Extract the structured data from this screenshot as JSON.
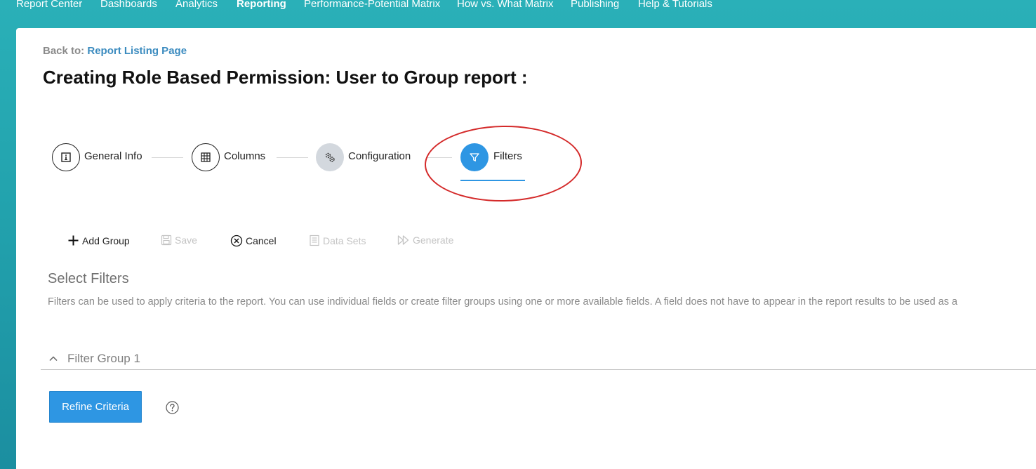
{
  "nav": {
    "items": [
      {
        "label": "Report Center",
        "active": false
      },
      {
        "label": "Dashboards",
        "active": false
      },
      {
        "label": "Analytics",
        "active": false
      },
      {
        "label": "Reporting",
        "active": true
      },
      {
        "label": "Performance-Potential Matrix",
        "active": false
      },
      {
        "label": "How vs. What Matrix",
        "active": false
      },
      {
        "label": "Publishing",
        "active": false
      },
      {
        "label": "Help & Tutorials",
        "active": false
      }
    ]
  },
  "header": {
    "back_prefix": "Back to:",
    "back_link": "Report Listing Page",
    "title": "Creating Role Based Permission: User to Group report :"
  },
  "steps": [
    {
      "label": "General Info",
      "icon": "info-icon",
      "state": "done"
    },
    {
      "label": "Columns",
      "icon": "grid-icon",
      "state": "done"
    },
    {
      "label": "Configuration",
      "icon": "gears-icon",
      "state": "pending"
    },
    {
      "label": "Filters",
      "icon": "filter-icon",
      "state": "active"
    }
  ],
  "toolbar": {
    "add_group": "Add Group",
    "save": "Save",
    "cancel": "Cancel",
    "data_sets": "Data Sets",
    "generate": "Generate"
  },
  "filters": {
    "title": "Select Filters",
    "description": "Filters can be used to apply criteria to the report. You can use individual fields or create filter groups using one or more available fields. A field does not have to appear in the report results to be used as a",
    "group_label": "Filter Group 1",
    "refine_button": "Refine Criteria"
  },
  "colors": {
    "accent": "#2e96e3",
    "link": "#3b8bbf",
    "annotation": "#d42a2a",
    "background": "#22a2ad"
  }
}
